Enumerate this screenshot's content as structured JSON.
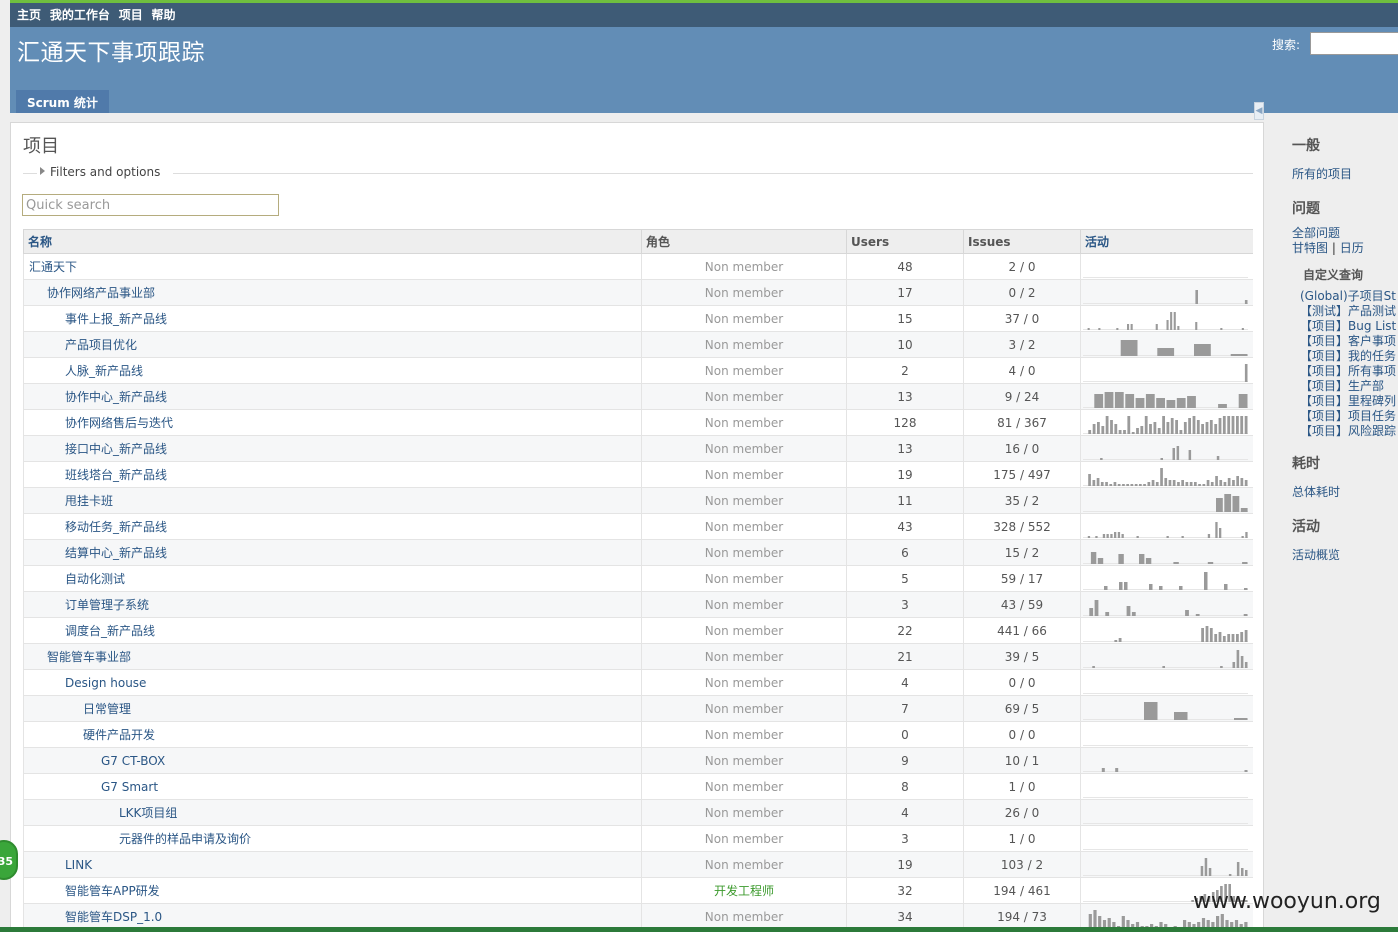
{
  "top_menu": [
    "主页",
    "我的工作台",
    "项目",
    "帮助"
  ],
  "header": {
    "title": "汇通天下事项跟踪",
    "search_label": "搜索:"
  },
  "main_menu": {
    "tab": "Scrum 统计"
  },
  "page": {
    "title": "项目",
    "filters_label": "Filters and options",
    "quick_search_placeholder": "Quick search"
  },
  "table": {
    "headers": {
      "name": "名称",
      "role": "角色",
      "users": "Users",
      "issues": "Issues",
      "activity": "活动"
    },
    "rows": [
      {
        "name": "汇通天下",
        "level": 0,
        "role": "Non member",
        "users": "48",
        "issues": "2 / 0",
        "bars": []
      },
      {
        "name": "协作网络产品事业部",
        "level": 1,
        "role": "Non member",
        "users": "17",
        "issues": "0 / 2",
        "bars": [
          0,
          0,
          0,
          0,
          0,
          0,
          0,
          0,
          0,
          0,
          0,
          0,
          0,
          0,
          0,
          0,
          0,
          0,
          0,
          0,
          0,
          0,
          0,
          0,
          0,
          0,
          0,
          0.7,
          0,
          0,
          0,
          0,
          0,
          0,
          0,
          0,
          0,
          0,
          0,
          0.2
        ]
      },
      {
        "name": "事件上报_新产品线",
        "level": 2,
        "role": "Non member",
        "users": "15",
        "issues": "37 / 0",
        "bars": [
          0,
          0.1,
          0,
          0,
          0.1,
          0,
          0,
          0,
          0,
          0.1,
          0,
          0,
          0.3,
          0.3,
          0,
          0,
          0,
          0,
          0,
          0,
          0.3,
          0,
          0,
          0.5,
          0.9,
          0.9,
          0.2,
          0,
          0,
          0,
          0,
          0.4,
          0,
          0,
          0,
          0,
          0,
          0,
          0.1,
          0,
          0,
          0,
          0,
          0,
          0.1,
          0
        ]
      },
      {
        "name": "产品项目优化",
        "level": 2,
        "role": "Non member",
        "users": "10",
        "issues": "3 / 2",
        "bars": [
          0,
          0,
          0.8,
          0,
          0.4,
          0,
          0.6,
          0,
          0.1
        ]
      },
      {
        "name": "人脉_新产品线",
        "level": 2,
        "role": "Non member",
        "users": "2",
        "issues": "4 / 0",
        "bars": [
          0,
          0,
          0,
          0,
          0,
          0,
          0,
          0,
          0,
          0,
          0,
          0,
          0,
          0,
          0,
          0,
          0,
          0,
          0,
          0,
          0,
          0,
          0,
          0,
          0,
          0,
          0,
          0,
          0,
          0,
          0,
          0,
          0,
          0,
          0,
          0,
          0,
          0,
          0,
          0.9
        ]
      },
      {
        "name": "协作中心_新产品线",
        "level": 2,
        "role": "Non member",
        "users": "13",
        "issues": "9 / 24",
        "bars": [
          0,
          0.7,
          0.8,
          0.8,
          0.7,
          0.5,
          0.7,
          0.5,
          0.4,
          0.5,
          0.6,
          0,
          0,
          0.2,
          0,
          0.7
        ]
      },
      {
        "name": "协作网络售后与迭代",
        "level": 2,
        "role": "Non member",
        "users": "128",
        "issues": "81 / 367",
        "bars": [
          0,
          0.2,
          0.5,
          0.6,
          0.4,
          0.9,
          0.7,
          0.5,
          0.2,
          0.2,
          0.9,
          0.1,
          0.3,
          0.4,
          0.9,
          0.5,
          0.6,
          0.3,
          0.9,
          0.6,
          0.8,
          0.7,
          0.2,
          0.6,
          0.8,
          0.9,
          0.7,
          0.5,
          0.6,
          0.7,
          0.5,
          0.8,
          0.9,
          0.9,
          0.9,
          0.9,
          0.9,
          0.9
        ]
      },
      {
        "name": "接口中心_新产品线",
        "level": 2,
        "role": "Non member",
        "users": "13",
        "issues": "16 / 0",
        "bars": [
          0,
          0,
          0,
          0,
          0.1,
          0,
          0,
          0,
          0,
          0,
          0,
          0,
          0,
          0,
          0,
          0,
          0,
          0,
          0,
          0.1,
          0,
          0,
          0.6,
          0.7,
          0,
          0,
          0.5,
          0,
          0,
          0,
          0,
          0,
          0,
          0.2,
          0,
          0,
          0,
          0,
          0,
          0,
          0
        ]
      },
      {
        "name": "班线塔台_新产品线",
        "level": 2,
        "role": "Non member",
        "users": "19",
        "issues": "175 / 497",
        "bars": [
          0,
          0.6,
          0.3,
          0.4,
          0.2,
          0.2,
          0.1,
          0.2,
          0.1,
          0.1,
          0.1,
          0.1,
          0.1,
          0.1,
          0.1,
          0.2,
          0.3,
          0.2,
          0.9,
          0.4,
          0.3,
          0.3,
          0.2,
          0.3,
          0.2,
          0.2,
          0.2,
          0.1,
          0.1,
          0.3,
          0.2,
          0.5,
          0.3,
          0.2,
          0.4,
          0.3,
          0.5,
          0.4,
          0.3
        ]
      },
      {
        "name": "甩挂卡班",
        "level": 2,
        "role": "Non member",
        "users": "11",
        "issues": "35 / 2",
        "bars": [
          0,
          0,
          0,
          0,
          0,
          0,
          0,
          0,
          0,
          0,
          0,
          0,
          0,
          0,
          0,
          0,
          0.7,
          0.9,
          0.8,
          0.2
        ]
      },
      {
        "name": "移动任务_新产品线",
        "level": 2,
        "role": "Non member",
        "users": "43",
        "issues": "328 / 552",
        "bars": [
          0,
          0.1,
          0,
          0.1,
          0,
          0.2,
          0.2,
          0.2,
          0.3,
          0.3,
          0.2,
          0,
          0,
          0,
          0.1,
          0,
          0,
          0,
          0,
          0,
          0,
          0,
          0.1,
          0,
          0,
          0,
          0.1,
          0,
          0,
          0,
          0,
          0,
          0,
          0.2,
          0,
          0.8,
          0.5,
          0,
          0,
          0,
          0,
          0,
          0.1,
          0.3
        ]
      },
      {
        "name": "结算中心_新产品线",
        "level": 2,
        "role": "Non member",
        "users": "6",
        "issues": "15 / 2",
        "bars": [
          0,
          0.6,
          0.3,
          0,
          0,
          0.5,
          0,
          0,
          0.5,
          0.3,
          0,
          0,
          0,
          0.1,
          0,
          0,
          0,
          0,
          0.1,
          0,
          0,
          0,
          0,
          0.1
        ]
      },
      {
        "name": "自动化测试",
        "level": 2,
        "role": "Non member",
        "users": "5",
        "issues": "59 / 17",
        "bars": [
          0,
          0,
          0,
          0,
          0.2,
          0,
          0,
          0.4,
          0.4,
          0,
          0,
          0,
          0,
          0.3,
          0,
          0.2,
          0,
          0,
          0,
          0.2,
          0,
          0,
          0,
          0,
          0.9,
          0,
          0,
          0,
          0.3,
          0,
          0,
          0,
          0.1
        ]
      },
      {
        "name": "订单管理子系统",
        "level": 2,
        "role": "Non member",
        "users": "3",
        "issues": "43 / 59",
        "bars": [
          0,
          0.4,
          0.8,
          0,
          0.2,
          0,
          0,
          0,
          0.5,
          0.2,
          0,
          0,
          0,
          0,
          0,
          0,
          0,
          0,
          0,
          0.3,
          0,
          0.1,
          0,
          0,
          0,
          0,
          0,
          0,
          0,
          0,
          0.1
        ]
      },
      {
        "name": "调度台_新产品线",
        "level": 2,
        "role": "Non member",
        "users": "22",
        "issues": "441 / 66",
        "bars": [
          0,
          0,
          0,
          0,
          0,
          0,
          0,
          0.1,
          0.2,
          0,
          0,
          0,
          0,
          0,
          0,
          0,
          0,
          0,
          0,
          0,
          0,
          0,
          0,
          0,
          0,
          0,
          0,
          0.7,
          0.8,
          0.7,
          0.4,
          0.5,
          0.3,
          0.4,
          0.4,
          0.4,
          0.5,
          0.6
        ]
      },
      {
        "name": "智能管车事业部",
        "level": 1,
        "role": "Non member",
        "users": "21",
        "issues": "39 / 5",
        "bars": [
          0,
          0,
          0.1,
          0,
          0,
          0,
          0,
          0,
          0,
          0,
          0,
          0,
          0,
          0,
          0,
          0,
          0,
          0,
          0,
          0.1,
          0,
          0,
          0,
          0,
          0,
          0,
          0,
          0,
          0,
          0,
          0,
          0,
          0,
          0.1,
          0,
          0,
          0.3,
          0.9,
          0.6,
          0.3
        ]
      },
      {
        "name": "Design house",
        "level": 2,
        "role": "Non member",
        "users": "4",
        "issues": "0 / 0",
        "bars": []
      },
      {
        "name": "日常管理",
        "level": 3,
        "role": "Non member",
        "users": "7",
        "issues": "69 / 5",
        "bars": [
          0,
          0,
          0,
          0,
          0.9,
          0,
          0.4,
          0,
          0,
          0,
          0.1
        ]
      },
      {
        "name": "硬件产品开发",
        "level": 3,
        "role": "Non member",
        "users": "0",
        "issues": "0 / 0",
        "bars": []
      },
      {
        "name": "G7 CT-BOX",
        "level": 4,
        "role": "Non member",
        "users": "9",
        "issues": "10 / 1",
        "bars": [
          0,
          0,
          0,
          0,
          0.2,
          0,
          0,
          0.2,
          0,
          0,
          0,
          0,
          0,
          0,
          0,
          0,
          0,
          0,
          0,
          0,
          0,
          0,
          0,
          0,
          0,
          0,
          0,
          0,
          0,
          0,
          0,
          0,
          0,
          0,
          0,
          0,
          0.1
        ]
      },
      {
        "name": "G7 Smart",
        "level": 4,
        "role": "Non member",
        "users": "8",
        "issues": "1 / 0",
        "bars": []
      },
      {
        "name": "LKK项目组",
        "level": 5,
        "role": "Non member",
        "users": "4",
        "issues": "26 / 0",
        "bars": []
      },
      {
        "name": "元器件的样品申请及询价",
        "level": 5,
        "role": "Non member",
        "users": "3",
        "issues": "1 / 0",
        "bars": []
      },
      {
        "name": "LINK",
        "level": 2,
        "role": "Non member",
        "users": "19",
        "issues": "103 / 2",
        "bars": [
          0,
          0,
          0,
          0,
          0,
          0,
          0,
          0,
          0,
          0,
          0,
          0,
          0,
          0,
          0,
          0,
          0,
          0,
          0,
          0,
          0,
          0,
          0,
          0,
          0,
          0,
          0,
          0,
          0,
          0.5,
          0.9,
          0.4,
          0,
          0,
          0,
          0,
          0.1,
          0,
          0.7,
          0.4,
          0.3
        ]
      },
      {
        "name": "智能管车APP研发",
        "level": 2,
        "role": "开发工程师",
        "member": true,
        "users": "32",
        "issues": "194 / 461",
        "bars": [
          0,
          0,
          0,
          0,
          0,
          0,
          0,
          0,
          0,
          0,
          0,
          0,
          0,
          0,
          0,
          0,
          0,
          0,
          0,
          0,
          0,
          0,
          0,
          0,
          0,
          0,
          0.1,
          0.2,
          0.3,
          0.4,
          0.3,
          0.5,
          0.6,
          0.8,
          0.9,
          0.9,
          0.3,
          0.2,
          0.1,
          0.1
        ]
      },
      {
        "name": "智能管车DSP_1.0",
        "level": 2,
        "role": "Non member",
        "users": "34",
        "issues": "194 / 73",
        "bars": [
          0,
          0.7,
          0.9,
          0.6,
          0.4,
          0.5,
          0.3,
          0.1,
          0.6,
          0.4,
          0.2,
          0.3,
          0.1,
          0.1,
          0.2,
          0.1,
          0.3,
          0.2,
          0,
          0.1,
          0,
          0.4,
          0.3,
          0.2,
          0.3,
          0.5,
          0.4,
          0.3,
          0.6,
          0.7,
          0.4,
          0.3,
          0.4,
          0.2,
          0.3
        ]
      }
    ]
  },
  "sidebar": {
    "general_title": "一般",
    "all_projects": "所有的项目",
    "issues_title": "问题",
    "all_issues": "全部问题",
    "gantt": "甘特图",
    "separator": "|",
    "calendar": "日历",
    "custom_queries_title": "自定义查询",
    "queries": [
      "(Global)子项目St",
      "【测试】产品测试",
      "【项目】Bug List",
      "【项目】客户事项",
      "【项目】我的任务",
      "【项目】所有事项",
      "【项目】生产部",
      "【项目】里程碑列",
      "【项目】项目任务",
      "【项目】风险跟踪"
    ],
    "time_title": "耗时",
    "total_time": "总体耗时",
    "activity_title": "活动",
    "activity_overview": "活动概览"
  },
  "bubble_label": "35",
  "watermark": "www.wooyun.org",
  "colors": {
    "top_menu": "#3e5b76",
    "header": "#628db6",
    "tab": "#507aaa",
    "link": "#2a5685",
    "bar": "#9a9a9a",
    "member_role": "#3c9a2d"
  }
}
